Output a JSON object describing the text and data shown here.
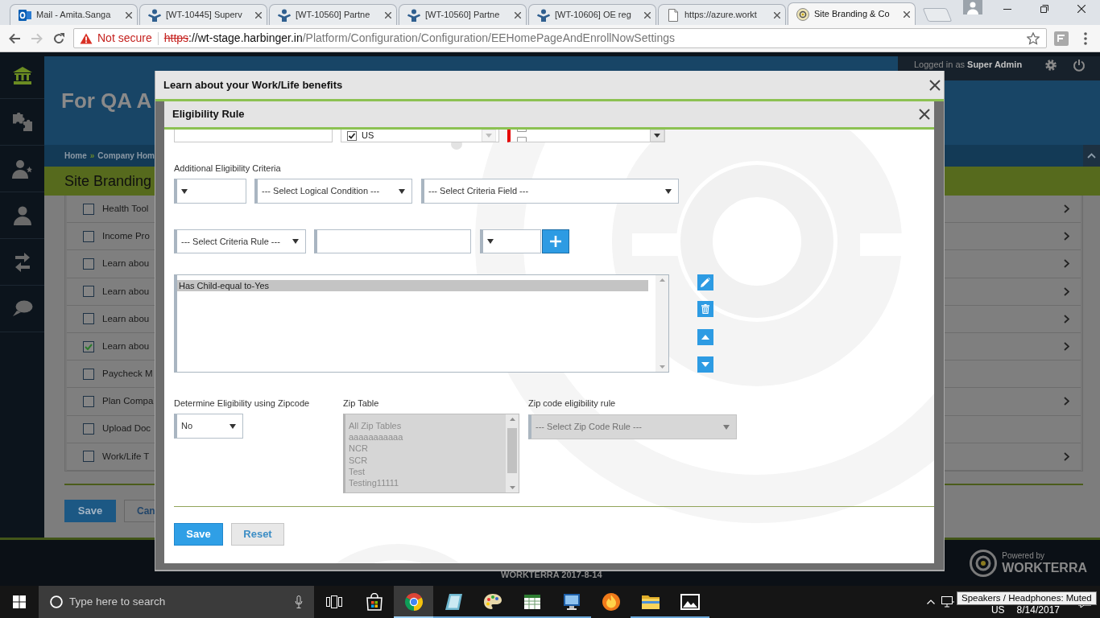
{
  "browser": {
    "tabs": [
      {
        "kind": "mail",
        "title": "Mail - Amita.Sanga",
        "selected": false
      },
      {
        "kind": "figure",
        "title": "[WT-10445] Superv",
        "selected": false
      },
      {
        "kind": "figure",
        "title": "[WT-10560] Partne",
        "selected": false
      },
      {
        "kind": "figure",
        "title": "[WT-10560] Partne",
        "selected": false
      },
      {
        "kind": "figure",
        "title": "[WT-10606] OE reg",
        "selected": false
      },
      {
        "kind": "page",
        "title": "https://azure.workt",
        "selected": false
      },
      {
        "kind": "site",
        "title": "Site Branding & Co",
        "selected": true
      }
    ],
    "address_bar": {
      "security": "Not secure",
      "scheme": "https",
      "host": "://wt-stage.harbinger.in",
      "path": "/Platform/Configuration/Configuration/EEHomePageAndEnrollNowSettings"
    }
  },
  "app": {
    "sidebar": [
      {
        "kind": "home",
        "selected": true
      },
      {
        "kind": "puzzle",
        "selected": false
      },
      {
        "kind": "user-star",
        "selected": false
      },
      {
        "kind": "user",
        "selected": false
      },
      {
        "kind": "transfer",
        "selected": false
      },
      {
        "kind": "chat",
        "selected": false
      }
    ],
    "user_bar": "Logged in as **Super Admin**",
    "banner_title": "For QA A",
    "breadcrumb": {
      "items": [
        "Home",
        "Company Hom"
      ],
      "separator": "»"
    },
    "section_title": "Site Branding",
    "list": [
      {
        "label": "Health Tool",
        "checked": false,
        "expandable": true
      },
      {
        "label": "Income Pro",
        "checked": false,
        "expandable": true
      },
      {
        "label": "Learn abou",
        "checked": false,
        "expandable": true
      },
      {
        "label": "Learn abou",
        "checked": false,
        "expandable": true
      },
      {
        "label": "Learn abou",
        "checked": false,
        "expandable": true
      },
      {
        "label": "Learn abou",
        "checked": true,
        "expandable": true
      },
      {
        "label": "Paycheck M",
        "checked": false,
        "expandable": false
      },
      {
        "label": "Plan Compa",
        "checked": false,
        "expandable": true
      },
      {
        "label": "Upload Doc",
        "checked": false,
        "expandable": false
      },
      {
        "label": "Work/Life T",
        "checked": false,
        "expandable": true
      }
    ],
    "buttons": [
      {
        "label": "Save",
        "kind": "primary"
      },
      {
        "label": "Can",
        "kind": "secondary"
      }
    ],
    "footer": {
      "version": "WORKTERRA 2017-8-14",
      "powered_by": "Powered by",
      "brand": "WORKTERRA"
    }
  },
  "dialog": {
    "title": "Learn about your Work/Life benefits"
  },
  "eligibility_dialog": {
    "title": "Eligibility Rule",
    "country": {
      "value": "US",
      "checked": true
    },
    "status_options": [
      {
        "checked": false
      },
      {
        "checked": false
      }
    ],
    "criteria_label": "Additional Eligibility Criteria",
    "logical_condition": "--- Select Logical Condition ---",
    "criteria_field": "--- Select Criteria Field ---",
    "criteria_rule": "--- Select Criteria Rule ---",
    "rules": [
      {
        "text": "Has Child-equal to-Yes",
        "selected": true
      }
    ],
    "zipcode": {
      "label": "Determine Eligibility using Zipcode",
      "value": "No"
    },
    "zip_table": {
      "label": "Zip Table",
      "disabled": true,
      "options": [
        "All Zip Tables",
        "aaaaaaaaaaa",
        "NCR",
        "SCR",
        "Test",
        "Testing11111"
      ]
    },
    "zip_rule": {
      "label": "Zip code eligibility rule",
      "value": "--- Select Zip Code Rule ---",
      "disabled": true
    },
    "buttons": [
      {
        "label": "Save",
        "kind": "primary"
      },
      {
        "label": "Reset",
        "kind": "secondary"
      }
    ]
  },
  "taskbar": {
    "search": {
      "placeholder": "Type here to search"
    },
    "apps": [
      {
        "kind": "store",
        "selected": false,
        "running": false
      },
      {
        "kind": "chrome",
        "selected": true,
        "running": true
      },
      {
        "kind": "reader",
        "selected": false,
        "running": true
      },
      {
        "kind": "paint",
        "selected": false,
        "running": true
      },
      {
        "kind": "spreadsheet",
        "selected": false,
        "running": true
      },
      {
        "kind": "remote",
        "selected": false,
        "running": true
      },
      {
        "kind": "flame",
        "selected": false,
        "running": false
      },
      {
        "kind": "folder",
        "selected": false,
        "running": true
      },
      {
        "kind": "photos",
        "selected": false,
        "running": true
      }
    ],
    "language": "US",
    "date": "8/14/2017",
    "tooltip": "Speakers / Headphones: Muted"
  }
}
